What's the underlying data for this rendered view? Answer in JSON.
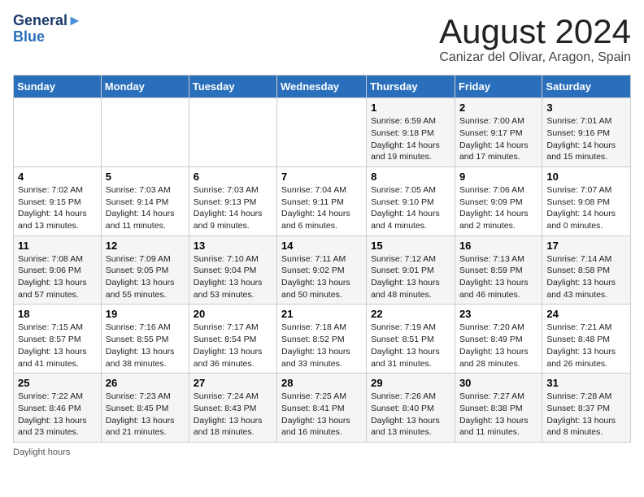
{
  "header": {
    "logo_line1": "General",
    "logo_line2": "Blue",
    "main_title": "August 2024",
    "subtitle": "Canizar del Olivar, Aragon, Spain"
  },
  "days_of_week": [
    "Sunday",
    "Monday",
    "Tuesday",
    "Wednesday",
    "Thursday",
    "Friday",
    "Saturday"
  ],
  "weeks": [
    [
      {
        "day": "",
        "info": ""
      },
      {
        "day": "",
        "info": ""
      },
      {
        "day": "",
        "info": ""
      },
      {
        "day": "",
        "info": ""
      },
      {
        "day": "1",
        "info": "Sunrise: 6:59 AM\nSunset: 9:18 PM\nDaylight: 14 hours\nand 19 minutes."
      },
      {
        "day": "2",
        "info": "Sunrise: 7:00 AM\nSunset: 9:17 PM\nDaylight: 14 hours\nand 17 minutes."
      },
      {
        "day": "3",
        "info": "Sunrise: 7:01 AM\nSunset: 9:16 PM\nDaylight: 14 hours\nand 15 minutes."
      }
    ],
    [
      {
        "day": "4",
        "info": "Sunrise: 7:02 AM\nSunset: 9:15 PM\nDaylight: 14 hours\nand 13 minutes."
      },
      {
        "day": "5",
        "info": "Sunrise: 7:03 AM\nSunset: 9:14 PM\nDaylight: 14 hours\nand 11 minutes."
      },
      {
        "day": "6",
        "info": "Sunrise: 7:03 AM\nSunset: 9:13 PM\nDaylight: 14 hours\nand 9 minutes."
      },
      {
        "day": "7",
        "info": "Sunrise: 7:04 AM\nSunset: 9:11 PM\nDaylight: 14 hours\nand 6 minutes."
      },
      {
        "day": "8",
        "info": "Sunrise: 7:05 AM\nSunset: 9:10 PM\nDaylight: 14 hours\nand 4 minutes."
      },
      {
        "day": "9",
        "info": "Sunrise: 7:06 AM\nSunset: 9:09 PM\nDaylight: 14 hours\nand 2 minutes."
      },
      {
        "day": "10",
        "info": "Sunrise: 7:07 AM\nSunset: 9:08 PM\nDaylight: 14 hours\nand 0 minutes."
      }
    ],
    [
      {
        "day": "11",
        "info": "Sunrise: 7:08 AM\nSunset: 9:06 PM\nDaylight: 13 hours\nand 57 minutes."
      },
      {
        "day": "12",
        "info": "Sunrise: 7:09 AM\nSunset: 9:05 PM\nDaylight: 13 hours\nand 55 minutes."
      },
      {
        "day": "13",
        "info": "Sunrise: 7:10 AM\nSunset: 9:04 PM\nDaylight: 13 hours\nand 53 minutes."
      },
      {
        "day": "14",
        "info": "Sunrise: 7:11 AM\nSunset: 9:02 PM\nDaylight: 13 hours\nand 50 minutes."
      },
      {
        "day": "15",
        "info": "Sunrise: 7:12 AM\nSunset: 9:01 PM\nDaylight: 13 hours\nand 48 minutes."
      },
      {
        "day": "16",
        "info": "Sunrise: 7:13 AM\nSunset: 8:59 PM\nDaylight: 13 hours\nand 46 minutes."
      },
      {
        "day": "17",
        "info": "Sunrise: 7:14 AM\nSunset: 8:58 PM\nDaylight: 13 hours\nand 43 minutes."
      }
    ],
    [
      {
        "day": "18",
        "info": "Sunrise: 7:15 AM\nSunset: 8:57 PM\nDaylight: 13 hours\nand 41 minutes."
      },
      {
        "day": "19",
        "info": "Sunrise: 7:16 AM\nSunset: 8:55 PM\nDaylight: 13 hours\nand 38 minutes."
      },
      {
        "day": "20",
        "info": "Sunrise: 7:17 AM\nSunset: 8:54 PM\nDaylight: 13 hours\nand 36 minutes."
      },
      {
        "day": "21",
        "info": "Sunrise: 7:18 AM\nSunset: 8:52 PM\nDaylight: 13 hours\nand 33 minutes."
      },
      {
        "day": "22",
        "info": "Sunrise: 7:19 AM\nSunset: 8:51 PM\nDaylight: 13 hours\nand 31 minutes."
      },
      {
        "day": "23",
        "info": "Sunrise: 7:20 AM\nSunset: 8:49 PM\nDaylight: 13 hours\nand 28 minutes."
      },
      {
        "day": "24",
        "info": "Sunrise: 7:21 AM\nSunset: 8:48 PM\nDaylight: 13 hours\nand 26 minutes."
      }
    ],
    [
      {
        "day": "25",
        "info": "Sunrise: 7:22 AM\nSunset: 8:46 PM\nDaylight: 13 hours\nand 23 minutes."
      },
      {
        "day": "26",
        "info": "Sunrise: 7:23 AM\nSunset: 8:45 PM\nDaylight: 13 hours\nand 21 minutes."
      },
      {
        "day": "27",
        "info": "Sunrise: 7:24 AM\nSunset: 8:43 PM\nDaylight: 13 hours\nand 18 minutes."
      },
      {
        "day": "28",
        "info": "Sunrise: 7:25 AM\nSunset: 8:41 PM\nDaylight: 13 hours\nand 16 minutes."
      },
      {
        "day": "29",
        "info": "Sunrise: 7:26 AM\nSunset: 8:40 PM\nDaylight: 13 hours\nand 13 minutes."
      },
      {
        "day": "30",
        "info": "Sunrise: 7:27 AM\nSunset: 8:38 PM\nDaylight: 13 hours\nand 11 minutes."
      },
      {
        "day": "31",
        "info": "Sunrise: 7:28 AM\nSunset: 8:37 PM\nDaylight: 13 hours\nand 8 minutes."
      }
    ]
  ],
  "daylight_note": "Daylight hours"
}
